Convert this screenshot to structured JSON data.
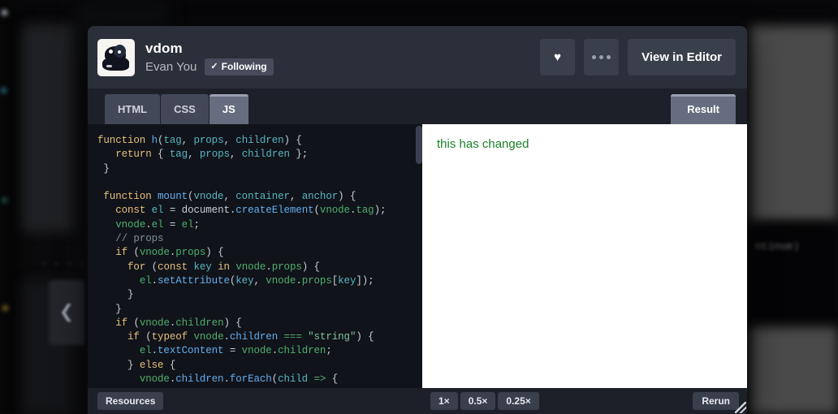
{
  "window": {
    "header": {
      "pen_title": "vdom",
      "author": "Evan You",
      "following_label": "Following",
      "following_check": "✓",
      "avatar_name": "user-avatar",
      "like_icon": "♥",
      "more_label": "more-options",
      "view_in_editor_label": "View in Editor"
    },
    "tabs": [
      {
        "id": "html",
        "label": "HTML",
        "active": false
      },
      {
        "id": "css",
        "label": "CSS",
        "active": false
      },
      {
        "id": "js",
        "label": "JS",
        "active": true
      }
    ],
    "result_tab_label": "Result",
    "editor": {
      "language": "JavaScript",
      "code_lines": [
        "function h(tag, props, children) {",
        "   return { tag, props, children };",
        " }",
        "",
        " function mount(vnode, container, anchor) {",
        "   const el = document.createElement(vnode.tag);",
        "   vnode.el = el;",
        "   // props",
        "   if (vnode.props) {",
        "     for (const key in vnode.props) {",
        "       el.setAttribute(key, vnode.props[key]);",
        "     }",
        "   }",
        "   if (vnode.children) {",
        "     if (typeof vnode.children === \"string\") {",
        "       el.textContent = vnode.children;",
        "     } else {",
        "       vnode.children.forEach(child => {"
      ],
      "scrollbar": "vertical-scrollbar"
    },
    "result": {
      "output_text": "this has changed",
      "output_color": "#1a8226"
    },
    "footer": {
      "resources_label": "Resources",
      "zoom_levels": [
        "1×",
        "0.5×",
        "0.25×"
      ],
      "rerun_label": "Rerun"
    }
  },
  "desktop": {
    "background_text": "ntinue)",
    "back_arrow_icon": "❮",
    "dots": "• • • •"
  },
  "colors": {
    "header_bg": "#2b2f3a",
    "tabbar_bg": "#1e2029",
    "tab_active_bg": "#676d80",
    "tab_bg": "#434858",
    "code_bg": "#11131a",
    "result_bg": "#ffffff",
    "accent_green": "#1a8226",
    "button_bg": "#3a3f4c"
  }
}
